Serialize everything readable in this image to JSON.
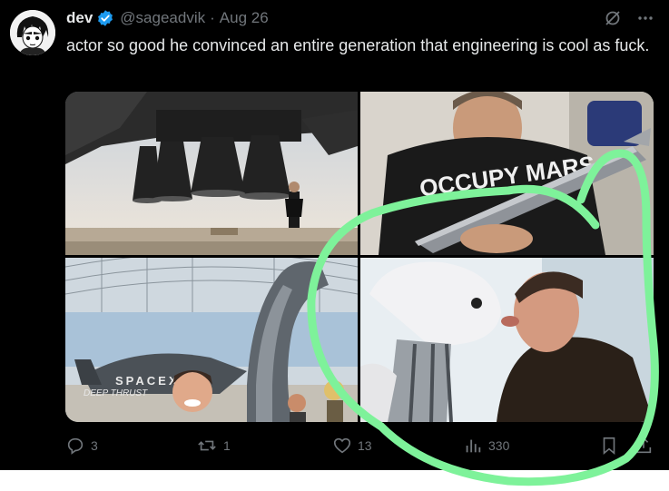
{
  "author": {
    "name": "dev",
    "handle": "@sageadvik",
    "separator": "·",
    "date": "Aug 26"
  },
  "tweet": {
    "text": "actor so good he convinced an entire generation that engineering is cool as fuck."
  },
  "images": [
    {
      "icon": "rocket-engines-photo"
    },
    {
      "icon": "man-hugging-starship-model-photo",
      "overlay_text": "OCCUPY MARS"
    },
    {
      "icon": "spacex-hangar-photo",
      "overlay_text": "SPACEX",
      "overlay_subtext": "DEEP THRUST"
    },
    {
      "icon": "man-kissing-robot-photo"
    }
  ],
  "actions": {
    "replies": "3",
    "reposts": "1",
    "likes": "13",
    "views": "330"
  },
  "colors": {
    "background": "#000000",
    "text": "#e7e9ea",
    "muted": "#71767b",
    "verified": "#1d9bf0",
    "scribble": "#7ef29a"
  }
}
